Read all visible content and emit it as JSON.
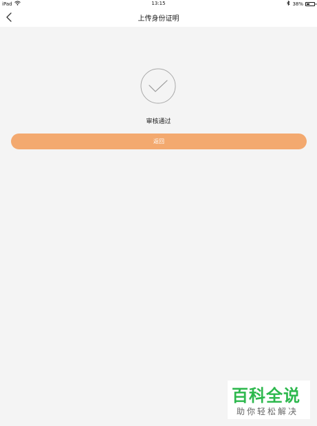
{
  "status_bar": {
    "device": "iPad",
    "time": "13:15",
    "battery": "38%",
    "battery_level": 0.38
  },
  "nav": {
    "title": "上传身份证明"
  },
  "result": {
    "status_text": "审核通过",
    "return_label": "返回"
  },
  "watermark": {
    "title": "百科全说",
    "subtitle": "助你轻松解决"
  },
  "colors": {
    "accent": "#f3a96f",
    "background": "#f4f4f4",
    "watermark_green": "#2db84d"
  }
}
